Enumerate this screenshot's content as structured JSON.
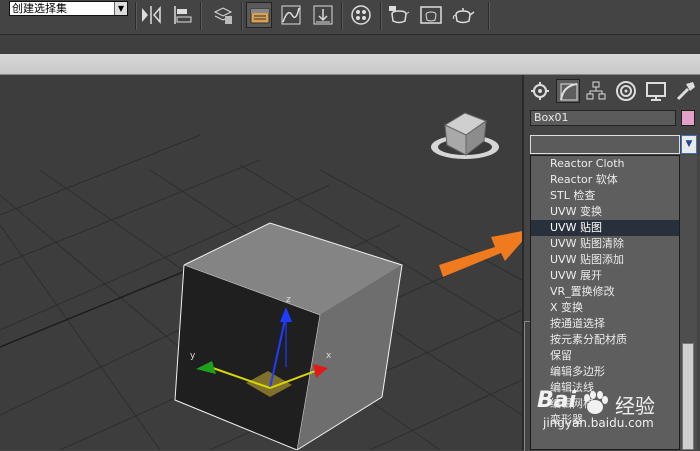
{
  "toolbar": {
    "selection_set": "创建选择集",
    "icons": [
      "mirror-icon",
      "align-icon",
      "layer-manager-icon",
      "scene-explorer-icon",
      "curve-editor-icon",
      "schematic-view-icon",
      "material-editor-icon",
      "render-setup-icon",
      "rendered-frame-icon",
      "render-teapot-icon"
    ]
  },
  "command_panel": {
    "tabs": [
      "create-tab",
      "modify-tab",
      "hierarchy-tab",
      "motion-tab",
      "display-tab",
      "utilities-tab"
    ],
    "object_name": "Box01",
    "object_color": "#e5a0c7",
    "modifier_list": {
      "items": [
        "Reactor Cloth",
        "Reactor 软体",
        "STL 检查",
        "UVW 变换",
        "UVW 贴图",
        "UVW 贴图清除",
        "UVW 贴图添加",
        "UVW 展开",
        "VR_置换修改",
        "X 变换",
        "按通道选择",
        "按元素分配材质",
        "保留",
        "编辑多边形",
        "编辑法线",
        "编辑网格",
        "变形器"
      ],
      "selected_index": 4
    }
  },
  "viewport": {
    "gizmo_labels": {
      "x": "x",
      "y": "y",
      "z": "z"
    }
  },
  "watermark": {
    "brand": "Bai",
    "cn": "经验",
    "url": "jingyan.baidu.com"
  },
  "colors": {
    "accent_arrow": "#f07a1e",
    "selection": "#28313b"
  }
}
